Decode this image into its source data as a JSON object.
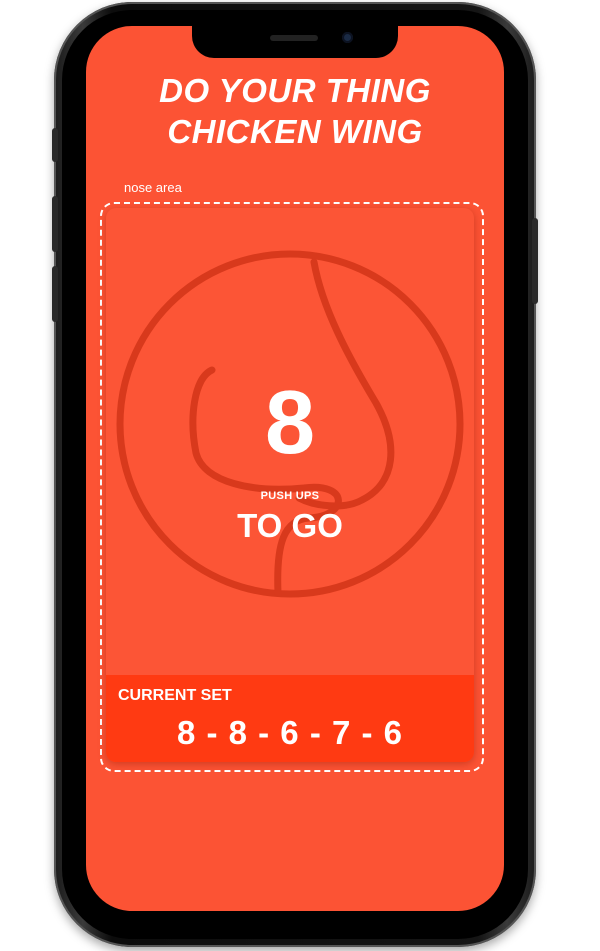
{
  "header": {
    "line1": "DO YOUR THING",
    "line2": "CHICKEN WING"
  },
  "nose_area": {
    "label": "nose area",
    "icon": "nose-outline-icon"
  },
  "counter": {
    "value": "8",
    "label": "PUSH UPS",
    "suffix": "TO GO"
  },
  "current_set": {
    "title": "CURRENT SET",
    "values": "8 - 8 - 6 - 7 - 6"
  },
  "colors": {
    "screen_bg": "#fc5334",
    "panel_bg": "#ff3a12",
    "nose_stroke": "#d8391c",
    "text": "#ffffff"
  }
}
